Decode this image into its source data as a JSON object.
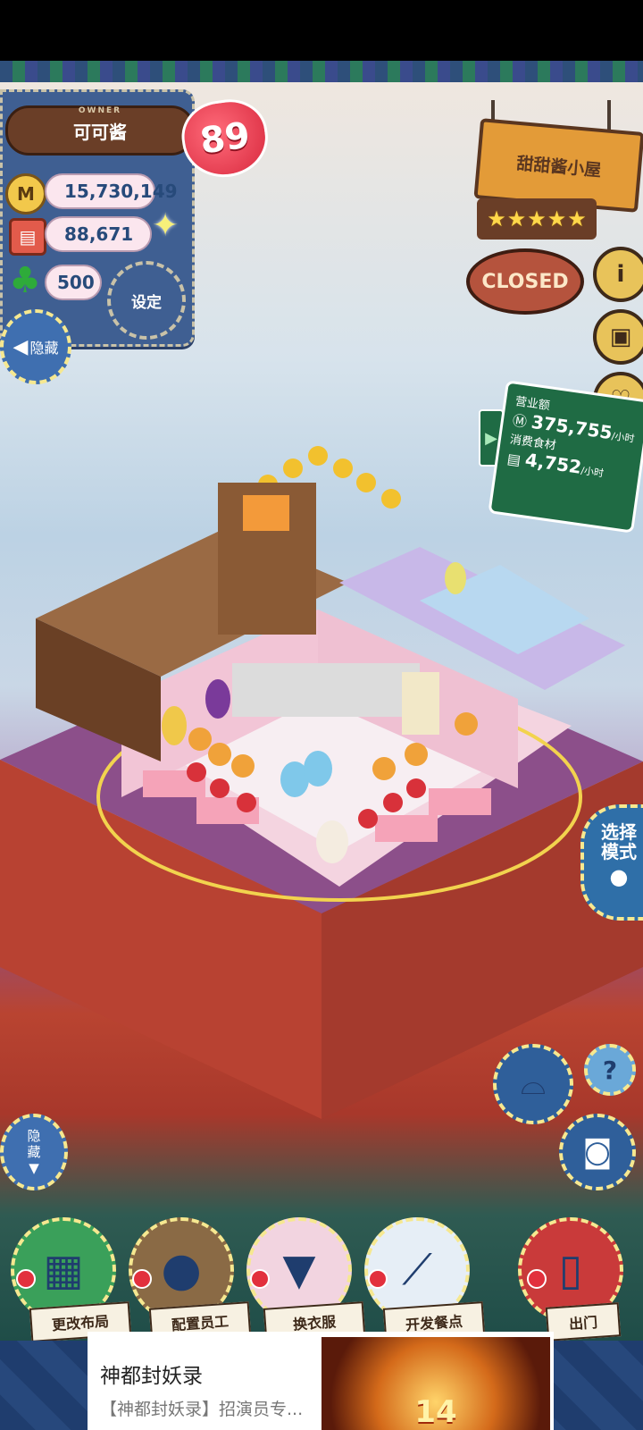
{
  "owner": {
    "caption": "OWNER",
    "name": "可可酱",
    "level": "89"
  },
  "resources": {
    "coins": "15,730,149",
    "food": "88,671",
    "clovers": "500"
  },
  "buttons": {
    "settings": "设定",
    "hide_top": "隐藏",
    "hide_bottom": "隐藏",
    "select_mode": "选择模式",
    "help": "?"
  },
  "shop": {
    "name": "甜甜酱小屋",
    "stars": 5,
    "status": "CLOSED"
  },
  "stats": {
    "revenue_label": "营业额",
    "revenue_value": "375,755",
    "revenue_unit": "/小时",
    "food_label": "消费食材",
    "food_value": "4,752",
    "food_unit": "/小时"
  },
  "bottom_menu": [
    {
      "label": "更改布局",
      "icon": "table-icon"
    },
    {
      "label": "配置员工",
      "icon": "bear-staff-icon"
    },
    {
      "label": "换衣服",
      "icon": "shirt-icon"
    },
    {
      "label": "开发餐点",
      "icon": "knife-icon"
    },
    {
      "label": "出门",
      "icon": "door-exit-icon"
    }
  ],
  "ad": {
    "title": "神都封妖录",
    "description": "【神都封妖录】招演员专...",
    "image_text": "14"
  },
  "colors": {
    "panel": "#3f5f92",
    "sign": "#e39b38",
    "stats_board": "#1f6b44",
    "heart": "#d8283d"
  }
}
